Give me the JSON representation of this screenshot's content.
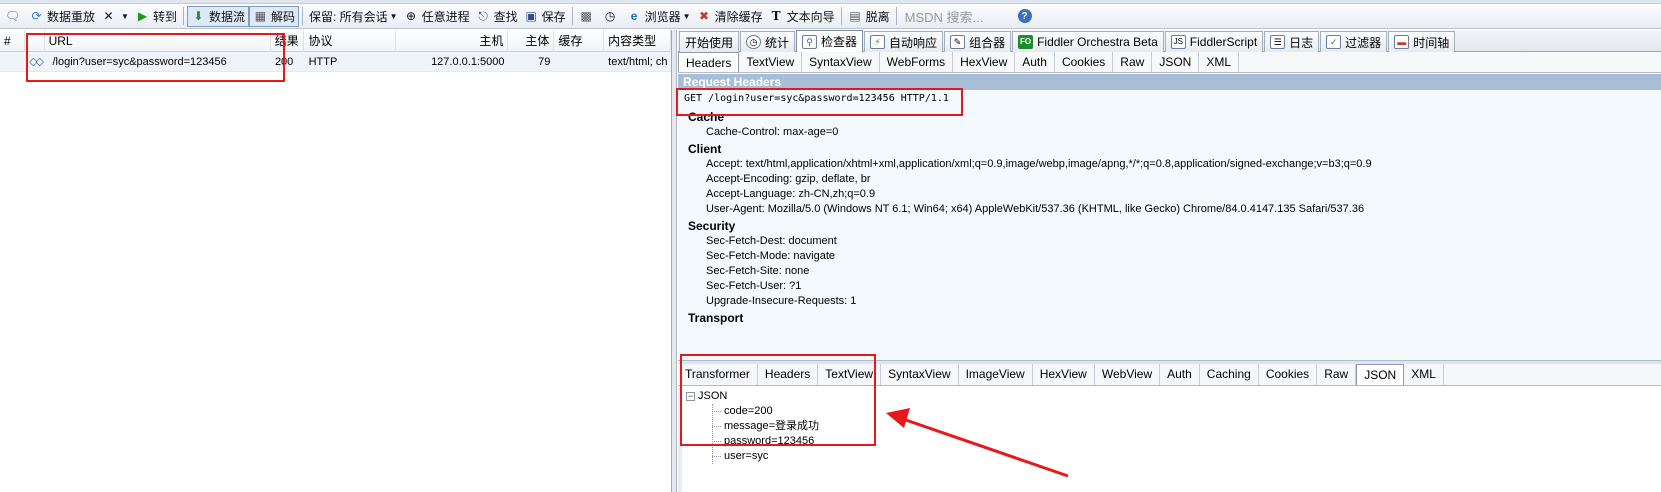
{
  "toolbar": {
    "items": [
      {
        "icon": "speech-bubble-icon",
        "label": ""
      },
      {
        "icon": "replay-icon",
        "label": "数据重放"
      },
      {
        "icon": "remove-icon",
        "label": ""
      },
      {
        "icon": "go-icon",
        "label": "转到"
      },
      {
        "icon": "stream-icon",
        "label": "数据流"
      },
      {
        "icon": "decode-icon",
        "label": "解码"
      },
      {
        "icon": "keep-label",
        "label": "保留: 所有会话"
      },
      {
        "icon": "crosshair-icon",
        "label": "任意进程"
      },
      {
        "icon": "binoculars-icon",
        "label": "查找"
      },
      {
        "icon": "save-icon",
        "label": "保存"
      },
      {
        "icon": "camera-icon",
        "label": ""
      },
      {
        "icon": "timer-icon",
        "label": ""
      },
      {
        "icon": "browser-icon",
        "label": "浏览器"
      },
      {
        "icon": "clear-cache-icon",
        "label": "清除缓存"
      },
      {
        "icon": "text-wizard-icon",
        "label": "文本向导"
      },
      {
        "icon": "tearoff-icon",
        "label": "脱离"
      }
    ],
    "search_placeholder": "MSDN 搜索...",
    "help": "?"
  },
  "sessions": {
    "columns": [
      "#",
      "",
      "URL",
      "结果",
      "协议",
      "主机",
      "主体",
      "缓存",
      "内容类型"
    ],
    "rows": [
      {
        "num": "",
        "icon": "◇◇",
        "url": "/login?user=syc&password=123456",
        "result": "200",
        "protocol": "HTTP",
        "host": "127.0.0.1:5000",
        "body": "79",
        "caching": "",
        "content_type": "text/html; ch"
      }
    ]
  },
  "main_tabs": [
    {
      "label": "开始使用",
      "icon": ""
    },
    {
      "label": "统计",
      "icon": "stats-icon"
    },
    {
      "label": "检查器",
      "icon": "inspector-icon",
      "active": true
    },
    {
      "label": "自动响应",
      "icon": "autoresponder-icon"
    },
    {
      "label": "组合器",
      "icon": "composer-icon"
    },
    {
      "label": "Fiddler Orchestra Beta",
      "icon": "fo-icon"
    },
    {
      "label": "FiddlerScript",
      "icon": "script-icon"
    },
    {
      "label": "日志",
      "icon": "log-icon"
    },
    {
      "label": "过滤器",
      "icon": "filter-check-icon"
    },
    {
      "label": "时间轴",
      "icon": "timeline-icon"
    }
  ],
  "request_tabs": [
    "Headers",
    "TextView",
    "SyntaxView",
    "WebForms",
    "HexView",
    "Auth",
    "Cookies",
    "Raw",
    "JSON",
    "XML"
  ],
  "request": {
    "title": "Request Headers",
    "request_line": "GET /login?user=syc&password=123456 HTTP/1.1",
    "groups": [
      {
        "name": "Cache",
        "headers": [
          "Cache-Control: max-age=0"
        ]
      },
      {
        "name": "Client",
        "headers": [
          "Accept: text/html,application/xhtml+xml,application/xml;q=0.9,image/webp,image/apng,*/*;q=0.8,application/signed-exchange;v=b3;q=0.9",
          "Accept-Encoding: gzip, deflate, br",
          "Accept-Language: zh-CN,zh;q=0.9",
          "User-Agent: Mozilla/5.0 (Windows NT 6.1; Win64; x64) AppleWebKit/537.36 (KHTML, like Gecko) Chrome/84.0.4147.135 Safari/537.36"
        ]
      },
      {
        "name": "Security",
        "headers": [
          "Sec-Fetch-Dest: document",
          "Sec-Fetch-Mode: navigate",
          "Sec-Fetch-Site: none",
          "Sec-Fetch-User: ?1",
          "Upgrade-Insecure-Requests: 1"
        ]
      },
      {
        "name": "Transport",
        "headers": []
      }
    ]
  },
  "response_tabs": [
    "Transformer",
    "Headers",
    "TextView",
    "SyntaxView",
    "ImageView",
    "HexView",
    "WebView",
    "Auth",
    "Caching",
    "Cookies",
    "Raw",
    "JSON",
    "XML"
  ],
  "response_active_tab": "JSON",
  "json_tree": {
    "expander": "−",
    "root": "JSON",
    "children": [
      "code=200",
      "message=登录成功",
      "password=123456",
      "user=syc"
    ]
  },
  "colors": {
    "annotation": "#e8171a",
    "accent": "#3c6fc4"
  }
}
